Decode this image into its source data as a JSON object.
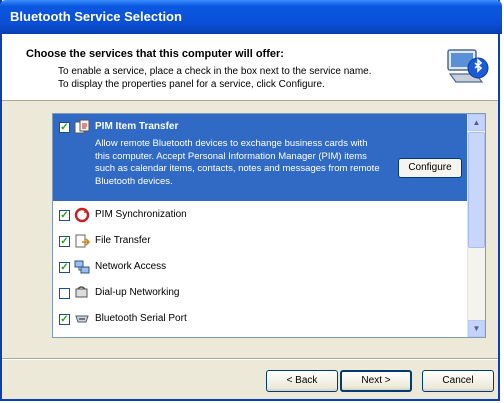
{
  "window": {
    "title": "Bluetooth Service Selection"
  },
  "header": {
    "title": "Choose the services that this computer will offer:",
    "line1": "To enable a service, place a check in the box next to the service name.",
    "line2": "To display the properties panel for a service, click Configure.",
    "icon": "computer-bluetooth-icon"
  },
  "services": {
    "selected": {
      "label": "PIM Item Transfer",
      "checked": true,
      "icon": "pim-transfer-icon",
      "description": "Allow remote Bluetooth devices to exchange business cards with this computer. Accept Personal Information Manager (PIM) items such as calendar items, contacts, notes and messages from remote Bluetooth devices.",
      "configure_label": "Configure"
    },
    "items": [
      {
        "label": "PIM Synchronization",
        "checked": true,
        "icon": "pim-sync-icon"
      },
      {
        "label": "File Transfer",
        "checked": true,
        "icon": "file-transfer-icon"
      },
      {
        "label": "Network Access",
        "checked": true,
        "icon": "network-access-icon"
      },
      {
        "label": "Dial-up Networking",
        "checked": false,
        "icon": "dialup-networking-icon"
      },
      {
        "label": "Bluetooth Serial Port",
        "checked": true,
        "icon": "serial-port-icon"
      }
    ]
  },
  "buttons": {
    "back": "< Back",
    "next": "Next >",
    "cancel": "Cancel"
  },
  "colors": {
    "title_bar": "#0a4fd6",
    "selection": "#316ac5",
    "dialog_bg": "#ece9d8"
  }
}
